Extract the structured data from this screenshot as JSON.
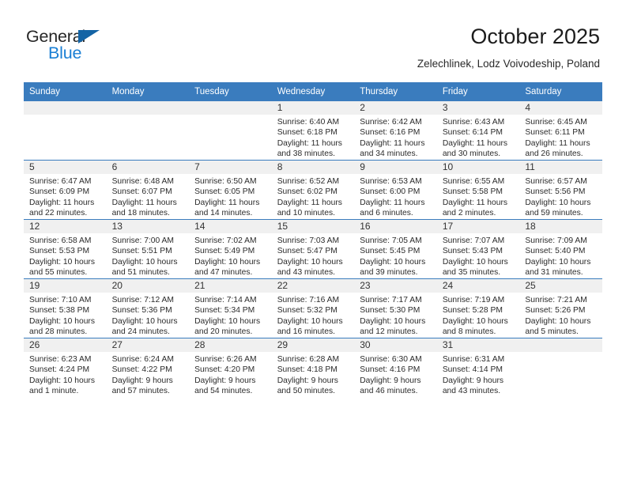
{
  "logo": {
    "word_one": "General",
    "word_two": "Blue",
    "triangle_color": "#1464a5",
    "blue_color": "#1a7fd4"
  },
  "header": {
    "title": "October 2025",
    "subtitle": "Zelechlinek, Lodz Voivodeship, Poland"
  },
  "theme": {
    "header_blue": "#3a7cbe",
    "daynum_band": "#f0f0f0",
    "text": "#2b2b2b"
  },
  "weekdays": [
    "Sunday",
    "Monday",
    "Tuesday",
    "Wednesday",
    "Thursday",
    "Friday",
    "Saturday"
  ],
  "weeks": [
    [
      {
        "day": "",
        "sunrise": "",
        "sunset": "",
        "daylight_line1": "",
        "daylight_line2": ""
      },
      {
        "day": "",
        "sunrise": "",
        "sunset": "",
        "daylight_line1": "",
        "daylight_line2": ""
      },
      {
        "day": "",
        "sunrise": "",
        "sunset": "",
        "daylight_line1": "",
        "daylight_line2": ""
      },
      {
        "day": "1",
        "sunrise": "Sunrise: 6:40 AM",
        "sunset": "Sunset: 6:18 PM",
        "daylight_line1": "Daylight: 11 hours",
        "daylight_line2": "and 38 minutes."
      },
      {
        "day": "2",
        "sunrise": "Sunrise: 6:42 AM",
        "sunset": "Sunset: 6:16 PM",
        "daylight_line1": "Daylight: 11 hours",
        "daylight_line2": "and 34 minutes."
      },
      {
        "day": "3",
        "sunrise": "Sunrise: 6:43 AM",
        "sunset": "Sunset: 6:14 PM",
        "daylight_line1": "Daylight: 11 hours",
        "daylight_line2": "and 30 minutes."
      },
      {
        "day": "4",
        "sunrise": "Sunrise: 6:45 AM",
        "sunset": "Sunset: 6:11 PM",
        "daylight_line1": "Daylight: 11 hours",
        "daylight_line2": "and 26 minutes."
      }
    ],
    [
      {
        "day": "5",
        "sunrise": "Sunrise: 6:47 AM",
        "sunset": "Sunset: 6:09 PM",
        "daylight_line1": "Daylight: 11 hours",
        "daylight_line2": "and 22 minutes."
      },
      {
        "day": "6",
        "sunrise": "Sunrise: 6:48 AM",
        "sunset": "Sunset: 6:07 PM",
        "daylight_line1": "Daylight: 11 hours",
        "daylight_line2": "and 18 minutes."
      },
      {
        "day": "7",
        "sunrise": "Sunrise: 6:50 AM",
        "sunset": "Sunset: 6:05 PM",
        "daylight_line1": "Daylight: 11 hours",
        "daylight_line2": "and 14 minutes."
      },
      {
        "day": "8",
        "sunrise": "Sunrise: 6:52 AM",
        "sunset": "Sunset: 6:02 PM",
        "daylight_line1": "Daylight: 11 hours",
        "daylight_line2": "and 10 minutes."
      },
      {
        "day": "9",
        "sunrise": "Sunrise: 6:53 AM",
        "sunset": "Sunset: 6:00 PM",
        "daylight_line1": "Daylight: 11 hours",
        "daylight_line2": "and 6 minutes."
      },
      {
        "day": "10",
        "sunrise": "Sunrise: 6:55 AM",
        "sunset": "Sunset: 5:58 PM",
        "daylight_line1": "Daylight: 11 hours",
        "daylight_line2": "and 2 minutes."
      },
      {
        "day": "11",
        "sunrise": "Sunrise: 6:57 AM",
        "sunset": "Sunset: 5:56 PM",
        "daylight_line1": "Daylight: 10 hours",
        "daylight_line2": "and 59 minutes."
      }
    ],
    [
      {
        "day": "12",
        "sunrise": "Sunrise: 6:58 AM",
        "sunset": "Sunset: 5:53 PM",
        "daylight_line1": "Daylight: 10 hours",
        "daylight_line2": "and 55 minutes."
      },
      {
        "day": "13",
        "sunrise": "Sunrise: 7:00 AM",
        "sunset": "Sunset: 5:51 PM",
        "daylight_line1": "Daylight: 10 hours",
        "daylight_line2": "and 51 minutes."
      },
      {
        "day": "14",
        "sunrise": "Sunrise: 7:02 AM",
        "sunset": "Sunset: 5:49 PM",
        "daylight_line1": "Daylight: 10 hours",
        "daylight_line2": "and 47 minutes."
      },
      {
        "day": "15",
        "sunrise": "Sunrise: 7:03 AM",
        "sunset": "Sunset: 5:47 PM",
        "daylight_line1": "Daylight: 10 hours",
        "daylight_line2": "and 43 minutes."
      },
      {
        "day": "16",
        "sunrise": "Sunrise: 7:05 AM",
        "sunset": "Sunset: 5:45 PM",
        "daylight_line1": "Daylight: 10 hours",
        "daylight_line2": "and 39 minutes."
      },
      {
        "day": "17",
        "sunrise": "Sunrise: 7:07 AM",
        "sunset": "Sunset: 5:43 PM",
        "daylight_line1": "Daylight: 10 hours",
        "daylight_line2": "and 35 minutes."
      },
      {
        "day": "18",
        "sunrise": "Sunrise: 7:09 AM",
        "sunset": "Sunset: 5:40 PM",
        "daylight_line1": "Daylight: 10 hours",
        "daylight_line2": "and 31 minutes."
      }
    ],
    [
      {
        "day": "19",
        "sunrise": "Sunrise: 7:10 AM",
        "sunset": "Sunset: 5:38 PM",
        "daylight_line1": "Daylight: 10 hours",
        "daylight_line2": "and 28 minutes."
      },
      {
        "day": "20",
        "sunrise": "Sunrise: 7:12 AM",
        "sunset": "Sunset: 5:36 PM",
        "daylight_line1": "Daylight: 10 hours",
        "daylight_line2": "and 24 minutes."
      },
      {
        "day": "21",
        "sunrise": "Sunrise: 7:14 AM",
        "sunset": "Sunset: 5:34 PM",
        "daylight_line1": "Daylight: 10 hours",
        "daylight_line2": "and 20 minutes."
      },
      {
        "day": "22",
        "sunrise": "Sunrise: 7:16 AM",
        "sunset": "Sunset: 5:32 PM",
        "daylight_line1": "Daylight: 10 hours",
        "daylight_line2": "and 16 minutes."
      },
      {
        "day": "23",
        "sunrise": "Sunrise: 7:17 AM",
        "sunset": "Sunset: 5:30 PM",
        "daylight_line1": "Daylight: 10 hours",
        "daylight_line2": "and 12 minutes."
      },
      {
        "day": "24",
        "sunrise": "Sunrise: 7:19 AM",
        "sunset": "Sunset: 5:28 PM",
        "daylight_line1": "Daylight: 10 hours",
        "daylight_line2": "and 8 minutes."
      },
      {
        "day": "25",
        "sunrise": "Sunrise: 7:21 AM",
        "sunset": "Sunset: 5:26 PM",
        "daylight_line1": "Daylight: 10 hours",
        "daylight_line2": "and 5 minutes."
      }
    ],
    [
      {
        "day": "26",
        "sunrise": "Sunrise: 6:23 AM",
        "sunset": "Sunset: 4:24 PM",
        "daylight_line1": "Daylight: 10 hours",
        "daylight_line2": "and 1 minute."
      },
      {
        "day": "27",
        "sunrise": "Sunrise: 6:24 AM",
        "sunset": "Sunset: 4:22 PM",
        "daylight_line1": "Daylight: 9 hours",
        "daylight_line2": "and 57 minutes."
      },
      {
        "day": "28",
        "sunrise": "Sunrise: 6:26 AM",
        "sunset": "Sunset: 4:20 PM",
        "daylight_line1": "Daylight: 9 hours",
        "daylight_line2": "and 54 minutes."
      },
      {
        "day": "29",
        "sunrise": "Sunrise: 6:28 AM",
        "sunset": "Sunset: 4:18 PM",
        "daylight_line1": "Daylight: 9 hours",
        "daylight_line2": "and 50 minutes."
      },
      {
        "day": "30",
        "sunrise": "Sunrise: 6:30 AM",
        "sunset": "Sunset: 4:16 PM",
        "daylight_line1": "Daylight: 9 hours",
        "daylight_line2": "and 46 minutes."
      },
      {
        "day": "31",
        "sunrise": "Sunrise: 6:31 AM",
        "sunset": "Sunset: 4:14 PM",
        "daylight_line1": "Daylight: 9 hours",
        "daylight_line2": "and 43 minutes."
      },
      {
        "day": "",
        "sunrise": "",
        "sunset": "",
        "daylight_line1": "",
        "daylight_line2": ""
      }
    ]
  ]
}
